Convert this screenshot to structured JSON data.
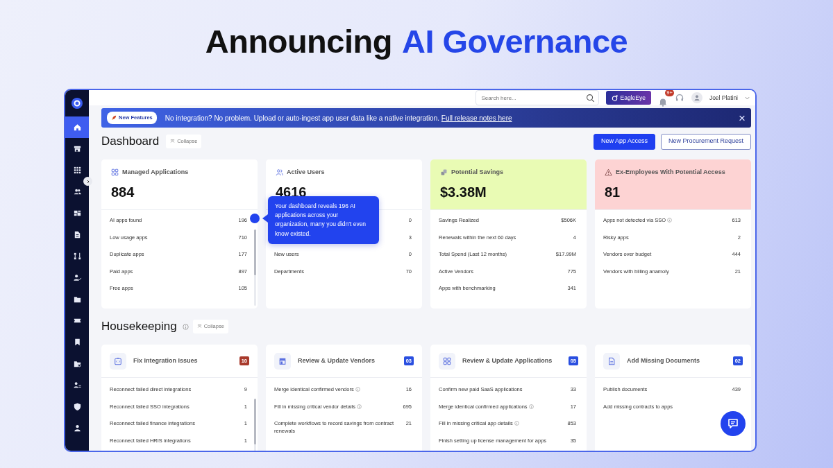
{
  "headline": {
    "text": "Announcing",
    "highlight": "AI Governance"
  },
  "sidebar": {
    "items": [
      {
        "selected": true
      },
      {
        "selected": false
      },
      {
        "selected": false
      },
      {
        "selected": false
      },
      {
        "selected": false
      },
      {
        "selected": false
      },
      {
        "selected": false
      },
      {
        "selected": false
      },
      {
        "selected": false
      },
      {
        "selected": false
      },
      {
        "selected": false
      },
      {
        "selected": false
      },
      {
        "selected": false
      },
      {
        "selected": false
      },
      {
        "selected": false
      }
    ]
  },
  "topbar": {
    "search": {
      "placeholder": "Search here..."
    },
    "eagle_button": "EagleEye",
    "notification_count": "9+",
    "user_name": "Joel Platini"
  },
  "banner": {
    "badge": "New Features",
    "message": "No integration? No problem. Upload or auto-ingest app user data like a native integration.",
    "link": "Full release notes here",
    "close": "×"
  },
  "dashboard": {
    "title": "Dashboard",
    "collapse": "Collapse",
    "buttons": [
      {
        "label": "New App Access",
        "kind": "primary"
      },
      {
        "label": "New Procurement Request",
        "kind": "outline"
      }
    ],
    "cards": [
      {
        "title": "Managed Applications",
        "value": "884",
        "color": "#ffffff",
        "scrollable": true,
        "rows": [
          {
            "label": "AI apps found",
            "value": "196"
          },
          {
            "label": "Low usage apps",
            "value": "710"
          },
          {
            "label": "Duplicate apps",
            "value": "177"
          },
          {
            "label": "Paid apps",
            "value": "897"
          },
          {
            "label": "Free apps",
            "value": "105"
          }
        ]
      },
      {
        "title": "Active Users",
        "value": "4616",
        "color": "#ffffff",
        "scrollable": false,
        "rows": [
          {
            "value": "0"
          },
          {
            "value": "3"
          },
          {
            "label": "New users",
            "value": "0"
          },
          {
            "label": "Departments",
            "value": "70"
          }
        ]
      },
      {
        "title": "Potential Savings",
        "value": "$3.38M",
        "color": "#e9fbb4",
        "scrollable": false,
        "rows": [
          {
            "label": "Savings Realized",
            "value": "$506K"
          },
          {
            "label": "Renewals within the next 60 days",
            "value": "4"
          },
          {
            "label": "Total Spend (Last 12 months)",
            "value": "$17.99M"
          },
          {
            "label": "Active Vendors",
            "value": "775"
          },
          {
            "label": "Apps with benchmarking",
            "value": "341"
          }
        ]
      },
      {
        "title": "Ex-Employees With Potential Access",
        "value": "81",
        "color": "#fdd3d3",
        "scrollable": false,
        "rows": [
          {
            "label": "Apps not detected via SSO",
            "value": "613",
            "info": true
          },
          {
            "label": "Risky apps",
            "value": "2"
          },
          {
            "label": "Vendors over budget",
            "value": "444"
          },
          {
            "label": "Vendors with billing anamoly",
            "value": "21"
          }
        ]
      }
    ],
    "tooltip": "Your dashboard reveals 196 AI applications across your organization, many you didn't even know existed."
  },
  "housekeeping": {
    "title": "Housekeeping",
    "collapse": "Collapse",
    "cards": [
      {
        "title": "Fix Integration Issues",
        "count": "10",
        "color": "#a83a2c",
        "scrollable": true,
        "rows": [
          {
            "label": "Reconnect failed direct integrations",
            "value": "9"
          },
          {
            "label": "Reconnect failed SSO integrations",
            "value": "1"
          },
          {
            "label": "Reconnect failed finance integrations",
            "value": "1"
          },
          {
            "label": "Reconnect failed HRIS integrations",
            "value": "1"
          }
        ]
      },
      {
        "title": "Review & Update Vendors",
        "count": "03",
        "color": "#2a4fe0",
        "scrollable": false,
        "rows": [
          {
            "label": "Merge identical confirmed vendors",
            "value": "16",
            "info": true
          },
          {
            "label": "Fill in missing critical vendor details",
            "value": "695",
            "info": true
          },
          {
            "label": "Complete workflows to record savings from contract renewals",
            "value": "21"
          }
        ]
      },
      {
        "title": "Review & Update Applications",
        "count": "05",
        "color": "#2a4fe0",
        "scrollable": false,
        "rows": [
          {
            "label": "Confirm new paid SaaS applications",
            "value": "33"
          },
          {
            "label": "Merge identical confirmed applications",
            "value": "17",
            "info": true
          },
          {
            "label": "Fill in missing critical app details",
            "value": "853",
            "info": true
          },
          {
            "label": "Finish setting up license management for apps",
            "value": "35"
          }
        ]
      },
      {
        "title": "Add Missing Documents",
        "count": "02",
        "color": "#2a4fe0",
        "scrollable": false,
        "rows": [
          {
            "label": "Publish documents",
            "value": "439"
          },
          {
            "label": "Add missing contracts to apps"
          }
        ]
      }
    ]
  }
}
